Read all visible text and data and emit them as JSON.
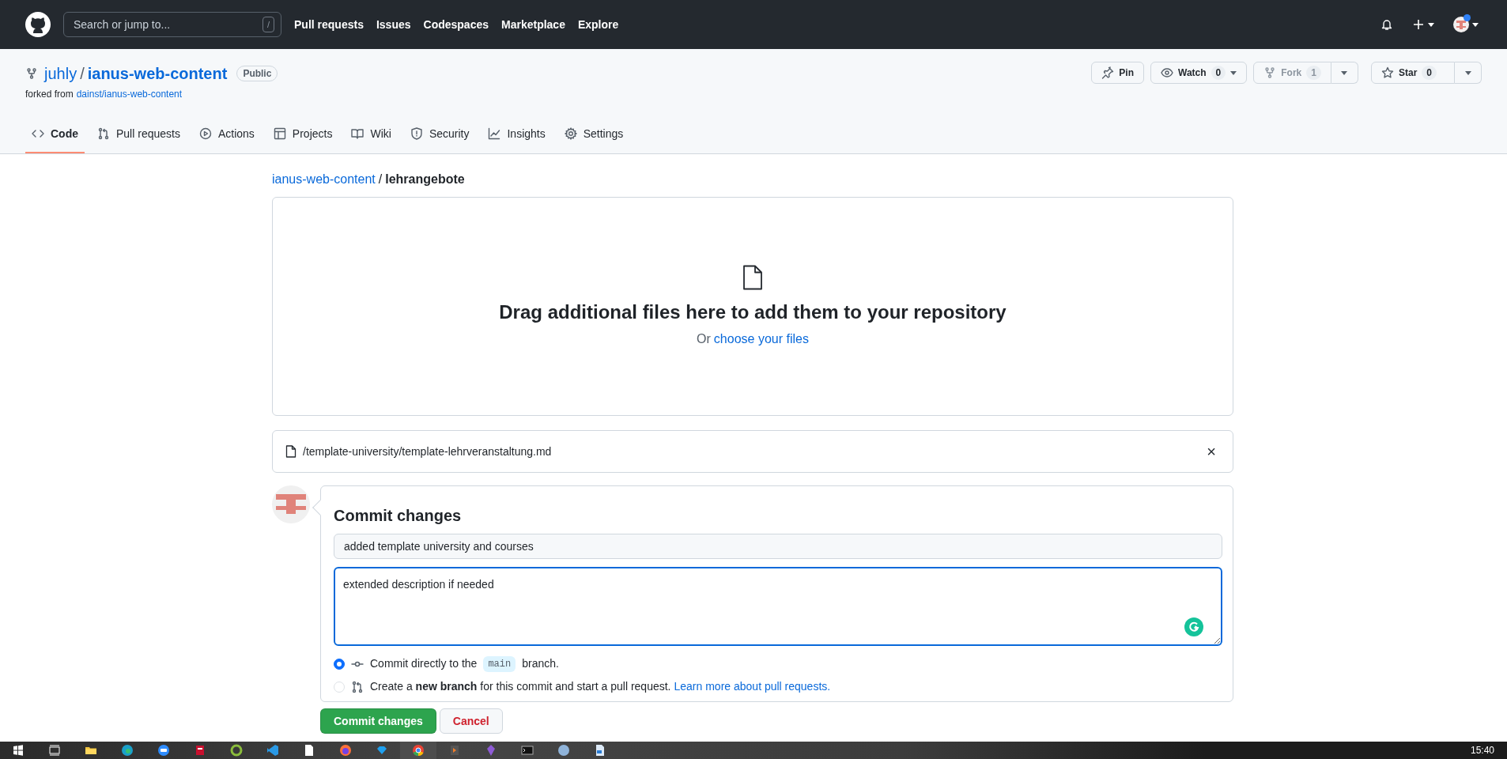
{
  "header": {
    "search": {
      "placeholder": "Search or jump to..."
    },
    "search_key": "/",
    "nav_links": [
      "Pull requests",
      "Issues",
      "Codespaces",
      "Marketplace",
      "Explore"
    ],
    "notification_dot": true
  },
  "repo": {
    "owner": "juhly",
    "separator": "/",
    "name": "ianus-web-content",
    "visibility": "Public",
    "forked_from_label": "forked from",
    "forked_from_link": "dainst/ianus-web-content",
    "actions": [
      {
        "kind": "pin",
        "label": "Pin",
        "disabled": false
      },
      {
        "kind": "watch",
        "label": "Watch",
        "count": "0",
        "disabled": false
      },
      {
        "kind": "fork",
        "label": "Fork",
        "count": "1",
        "disabled": true
      },
      {
        "kind": "star",
        "label": "Star",
        "count": "0",
        "disabled": false
      }
    ]
  },
  "tabs": [
    {
      "kind": "code",
      "label": "Code",
      "selected": true
    },
    {
      "kind": "pull-request",
      "label": "Pull requests",
      "selected": false
    },
    {
      "kind": "actions",
      "label": "Actions",
      "selected": false
    },
    {
      "kind": "projects",
      "label": "Projects",
      "selected": false
    },
    {
      "kind": "wiki",
      "label": "Wiki",
      "selected": false
    },
    {
      "kind": "security",
      "label": "Security",
      "selected": false
    },
    {
      "kind": "insights",
      "label": "Insights",
      "selected": false
    },
    {
      "kind": "settings",
      "label": "Settings",
      "selected": false
    }
  ],
  "breadcrumb": {
    "repo_link": "ianus-web-content",
    "separator": "/",
    "folder": "lehrangebote"
  },
  "dropzone": {
    "title": "Drag additional files here to add them to your repository",
    "prompt": "Or",
    "link": "choose your files"
  },
  "file": {
    "path": "/template-university/template-lehrveranstaltung.md",
    "remove": "×"
  },
  "commit": {
    "title": "Commit changes",
    "summary": "added template university and courses",
    "description": "extended description if needed",
    "options": [
      {
        "kind": "direct",
        "text": "Commit directly to the",
        "branch": "main",
        "text_after": "branch.",
        "selected": true
      },
      {
        "kind": "new-branch",
        "text": "Create a **new branch** for this commit and start a pull request.",
        "link": "Learn more about pull requests.",
        "selected": false
      }
    ],
    "submit": "Commit changes",
    "cancel": "Cancel"
  },
  "taskbar": {
    "time": "15:40"
  }
}
